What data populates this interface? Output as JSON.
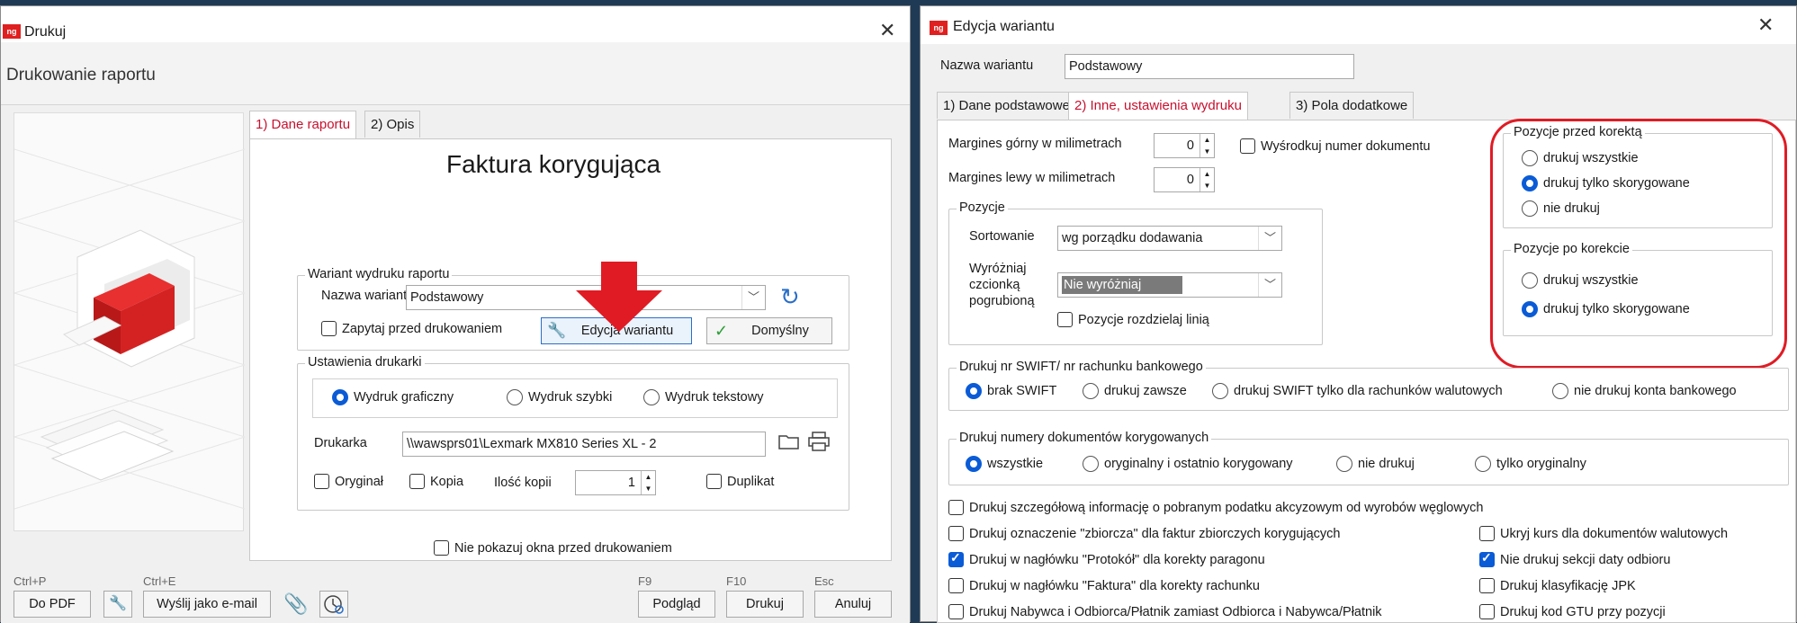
{
  "drukuj": {
    "window_title": "Drukuj",
    "app_icon": "ng",
    "header": "Drukowanie raportu",
    "tabs": [
      "1) Dane raportu",
      "2) Opis"
    ],
    "report_title": "Faktura korygująca",
    "variant_group": {
      "title": "Wariant wydruku raportu",
      "name_label": "Nazwa wariantu",
      "name_value": "Podstawowy",
      "ask_before_print": "Zapytaj przed drukowaniem",
      "edit_button": "Edycja wariantu",
      "default_button": "Domyślny"
    },
    "printer_group": {
      "title": "Ustawienia drukarki",
      "modes": [
        "Wydruk graficzny",
        "Wydruk szybki",
        "Wydruk tekstowy"
      ],
      "selected_mode": 0,
      "printer_label": "Drukarka",
      "printer_value": "\\\\wawsprs01\\Lexmark MX810 Series XL - 2",
      "original": "Oryginał",
      "copy": "Kopia",
      "copies_label": "Ilość kopii",
      "copies_value": "1",
      "duplicate": "Duplikat"
    },
    "hide_window": "Nie pokazuj okna przed drukowaniem",
    "footer": {
      "pdf_shortcut": "Ctrl+P",
      "pdf_button": "Do PDF",
      "email_shortcut": "Ctrl+E",
      "email_button": "Wyślij jako e-mail",
      "preview_shortcut": "F9",
      "preview_button": "Podgląd",
      "print_shortcut": "F10",
      "print_button": "Drukuj",
      "cancel_shortcut": "Esc",
      "cancel_button": "Anuluj"
    }
  },
  "edycja": {
    "window_title": "Edycja wariantu",
    "app_icon": "ng",
    "name_label": "Nazwa wariantu",
    "name_value": "Podstawowy",
    "tabs": [
      "1) Dane podstawowe",
      "2) Inne, ustawienia wydruku",
      "3) Pola dodatkowe"
    ],
    "margin_top_label": "Margines górny w milimetrach",
    "margin_top_value": "0",
    "margin_left_label": "Margines lewy w milimetrach",
    "margin_left_value": "0",
    "center_doc_number": "Wyśrodkuj numer dokumentu",
    "positions_group": {
      "title": "Pozycje",
      "sort_label": "Sortowanie",
      "sort_value": "wg porządku dodawania",
      "bold_label_1": "Wyróżniaj",
      "bold_label_2": "czcionką",
      "bold_label_3": "pogrubioną",
      "bold_value": "Nie wyróżniaj",
      "separate_line": "Pozycje rozdzielaj linią"
    },
    "before_group": {
      "title": "Pozycje przed korektą",
      "options": [
        "drukuj wszystkie",
        "drukuj tylko skorygowane",
        "nie drukuj"
      ],
      "selected": 1
    },
    "after_group": {
      "title": "Pozycje po korekcie",
      "options": [
        "drukuj wszystkie",
        "drukuj tylko skorygowane"
      ],
      "selected": 1
    },
    "swift_group": {
      "title": "Drukuj nr SWIFT/ nr rachunku bankowego",
      "options": [
        "brak SWIFT",
        "drukuj zawsze",
        "drukuj SWIFT tylko dla rachunków walutowych",
        "nie drukuj konta bankowego"
      ],
      "selected": 0
    },
    "corrected_group": {
      "title": "Drukuj numery dokumentów korygowanych",
      "options": [
        "wszystkie",
        "oryginalny i ostatnio korygowany",
        "nie drukuj",
        "tylko oryginalny"
      ],
      "selected": 0
    },
    "checks_left": [
      {
        "label": "Drukuj szczegółową informację o pobranym podatku akcyzowym od wyrobów węglowych",
        "checked": false
      },
      {
        "label": "Drukuj oznaczenie \"zbiorcza\" dla faktur zbiorczych korygujących",
        "checked": false
      },
      {
        "label": "Drukuj w nagłówku \"Protokół\" dla korekty paragonu",
        "checked": true
      },
      {
        "label": "Drukuj w nagłówku \"Faktura\" dla korekty rachunku",
        "checked": false
      },
      {
        "label": "Drukuj Nabywca i Odbiorca/Płatnik zamiast Odbiorca i Nabywca/Płatnik",
        "checked": false
      }
    ],
    "checks_right": [
      {
        "label": "Ukryj kurs dla dokumentów walutowych",
        "checked": false
      },
      {
        "label": "Nie drukuj sekcji daty odbioru",
        "checked": true
      },
      {
        "label": "Drukuj klasyfikację JPK",
        "checked": false
      },
      {
        "label": "Drukuj kod GTU przy pozycji",
        "checked": false
      }
    ]
  },
  "colors": {
    "accent": "#0a5bd6",
    "active_tab": "#c8102e",
    "annotation": "#e01b24",
    "bold_select": "#7a7a7a"
  }
}
